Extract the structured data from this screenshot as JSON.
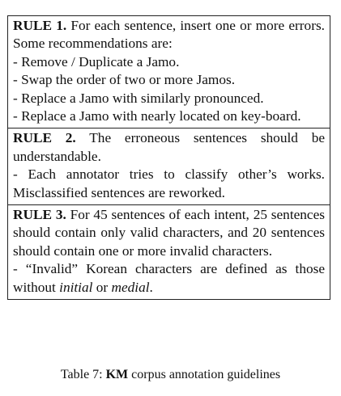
{
  "table": {
    "rules": [
      {
        "head": "RULE 1.",
        "lead": "For each sentence, insert one or more errors. Some recommendations are:",
        "bullets": [
          "- Remove / Duplicate a Jamo.",
          "- Swap the order of two or more Jamos.",
          "- Replace a Jamo with similarly pronounced.",
          "- Replace a Jamo with nearly located on key-board."
        ]
      },
      {
        "head": "RULE 2.",
        "lead": "The erroneous sentences should be understandable.",
        "bullets": [
          "- Each annotator tries to classify other’s works. Misclassified sentences are reworked."
        ]
      },
      {
        "head": "RULE 3.",
        "lead": "For 45 sentences of each intent, 25 sentences should contain only valid characters, and 20 sentences should contain one or more invalid characters.",
        "bullets": [],
        "note": {
          "prefix": "- “Invalid” Korean characters are defined as those without",
          "term1": "initial",
          "mid": "or",
          "term2": "medial",
          "end": "."
        }
      }
    ]
  },
  "caption": {
    "prefix": "Table 7:",
    "bold": "KM",
    "suffix": "corpus annotation guidelines"
  }
}
